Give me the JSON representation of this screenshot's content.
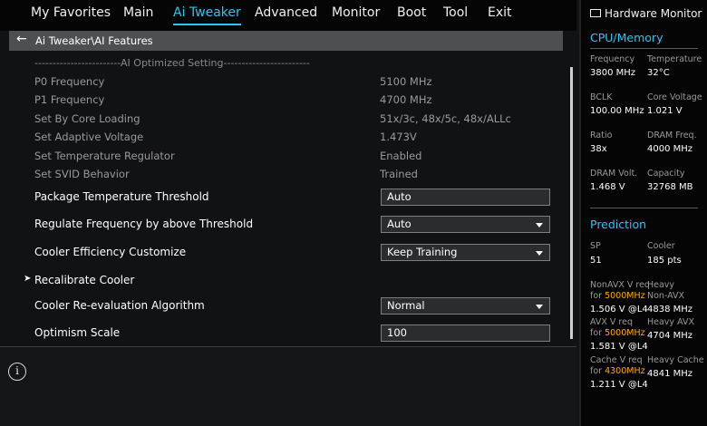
{
  "menu": {
    "tabs": [
      {
        "label": "My Favorites"
      },
      {
        "label": "Main"
      },
      {
        "label": "Ai Tweaker"
      },
      {
        "label": "Advanced"
      },
      {
        "label": "Monitor"
      },
      {
        "label": "Boot"
      },
      {
        "label": "Tool"
      },
      {
        "label": "Exit"
      }
    ],
    "active": "Ai Tweaker"
  },
  "breadcrumb": {
    "text": "Ai Tweaker\\AI Features"
  },
  "separator": "------------------------AI Optimized Setting------------------------",
  "info_rows": [
    {
      "label": "P0 Frequency",
      "value": "5100 MHz"
    },
    {
      "label": "P1 Frequency",
      "value": "4700 MHz"
    },
    {
      "label": "Set By Core Loading",
      "value": "51x/3c, 48x/5c, 48x/ALLc"
    },
    {
      "label": "Set Adaptive Voltage",
      "value": "1.473V"
    },
    {
      "label": "Set Temperature Regulator",
      "value": "Enabled"
    },
    {
      "label": "Set SVID Behavior",
      "value": "Trained"
    }
  ],
  "settings": [
    {
      "label": "Package Temperature Threshold",
      "value": "Auto",
      "control": "input"
    },
    {
      "label": "Regulate Frequency by above Threshold",
      "value": "Auto",
      "control": "dropdown"
    },
    {
      "label": "Cooler Efficiency Customize",
      "value": "Keep Training",
      "control": "dropdown"
    },
    {
      "label": "Recalibrate Cooler",
      "control": "submenu"
    },
    {
      "label": "Cooler Re-evaluation Algorithm",
      "value": "Normal",
      "control": "dropdown"
    },
    {
      "label": "Optimism Scale",
      "value": "100",
      "control": "input"
    }
  ],
  "hardware_monitor": {
    "title": "Hardware Monitor",
    "cpu_memory": {
      "title": "CPU/Memory",
      "items": [
        {
          "label": "Frequency",
          "value": "3800 MHz"
        },
        {
          "label": "Temperature",
          "value": "32°C"
        },
        {
          "label": "BCLK",
          "value": "100.00 MHz"
        },
        {
          "label": "Core Voltage",
          "value": "1.021 V"
        },
        {
          "label": "Ratio",
          "value": "38x"
        },
        {
          "label": "DRAM Freq.",
          "value": "4000 MHz"
        },
        {
          "label": "DRAM Volt.",
          "value": "1.468 V"
        },
        {
          "label": "Capacity",
          "value": "32768 MB"
        }
      ]
    },
    "prediction": {
      "title": "Prediction",
      "sp": {
        "label": "SP",
        "value": "51"
      },
      "cooler": {
        "label": "Cooler",
        "value": "185 pts"
      },
      "nonavx": {
        "label": "NonAVX V req",
        "for": "for ",
        "freq": "5000MHz",
        "value": "1.506 V @L4"
      },
      "heavy_nonavx": {
        "label1": "Heavy",
        "label2": "Non-AVX",
        "value": "4838 MHz"
      },
      "avx": {
        "label": "AVX V req",
        "for": "for ",
        "freq": "5000MHz",
        "value": "1.581 V @L4"
      },
      "heavy_avx": {
        "label": "Heavy AVX",
        "value": "4704 MHz"
      },
      "cache": {
        "label": "Cache V req",
        "for": "for ",
        "freq": "4300MHz",
        "value": "1.211 V @L4"
      },
      "heavy_cache": {
        "label": "Heavy Cache",
        "value": "4841 MHz"
      }
    },
    "colors": {
      "accent": "#2dc4f0",
      "highlight": "#ffa800"
    }
  }
}
